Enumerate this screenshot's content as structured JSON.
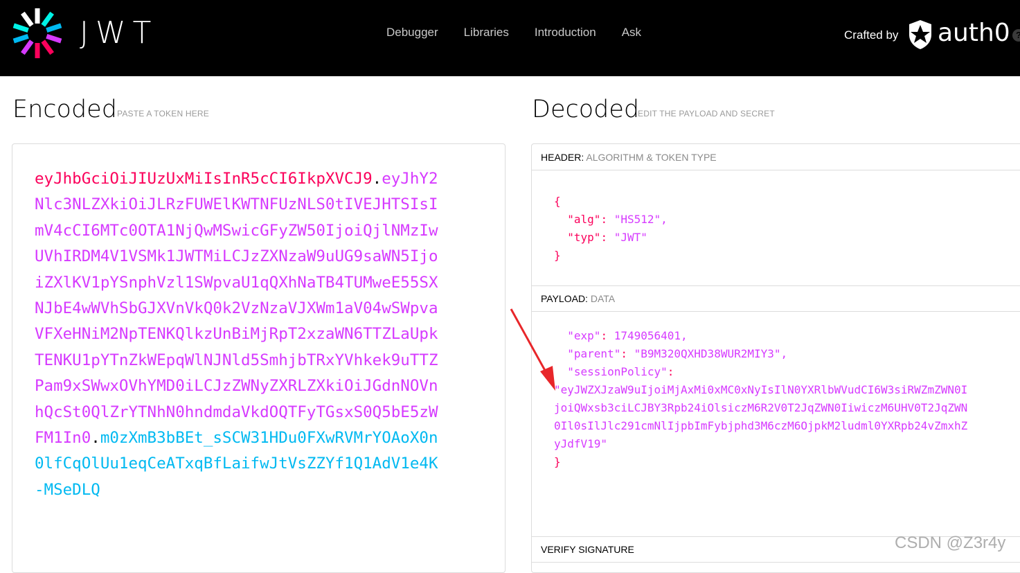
{
  "header": {
    "brand": "JWT",
    "nav": [
      "Debugger",
      "Libraries",
      "Introduction",
      "Ask"
    ],
    "crafted_by": "Crafted by",
    "partner": "auth0",
    "help": "?"
  },
  "encoded": {
    "title": "Encoded",
    "subtitle": "PASTE A TOKEN HERE",
    "token_header": "eyJhbGciOiJIUzUxMiIsInR5cCI6IkpXVCJ9",
    "token_payload": "eyJhY2Nlc3NLZXkiOiJLRzFUWElKWTNFUzNLS0tIVEJHTSIsImV4cCI6MTc0OTA1NjQwMSwicGFyZW50IjoiQjlNMzIwUVhIRDM4V1VSMk1JWTMiLCJzZXNzaW9uUG9saWN5IjoiZXlKV1pYSnphVzl1SWpvaU1qQXhNaTB4TUMweE55SXNJbE4wWVhSbGJXVnVkQ0k2VzNzaVJXWm1aV04wSWpvaVFXeHNiM2NpTENKQlkzUnBiMjRpT2xzaWN6TTZLaUpkTENKU1pYTnZkWEpqWlNJNld5SmhjbTRxYVhkek9uTTZPam9xSWwxOVhYMD0iLCJzZWNyZXRLZXkiOiJGdnNOVnhQcSt0QlZrYTNhN0hndmdaVkdOQTFyTGsxS0Q5bE5zWFM1In0",
    "token_signature": "m0zXmB3bBEt_sSCW31HDu0FXwRVMrYOAoX0n0lfCqOlUu1eqCeATxqBfLaifwJtVsZZYf1Q1AdV1e4K-MSeDLQ"
  },
  "decoded": {
    "title": "Decoded",
    "subtitle": "EDIT THE PAYLOAD AND SECRET",
    "header_label": "HEADER:",
    "header_desc": "ALGORITHM & TOKEN TYPE",
    "payload_label": "PAYLOAD:",
    "payload_desc": "DATA",
    "verify_label": "VERIFY SIGNATURE",
    "header_json": {
      "alg_key": "\"alg\"",
      "alg_val": "\"HS512\",",
      "typ_key": "\"typ\"",
      "typ_val": "\"JWT\""
    },
    "payload_json": {
      "exp_key": "\"exp\"",
      "exp_val": "1749056401,",
      "parent_key": "\"parent\"",
      "parent_val": "\"B9M320QXHD38WUR2MIY3\",",
      "session_key": "\"sessionPolicy\"",
      "session_val": "\"eyJWZXJzaW9uIjoiMjAxMi0xMC0xNyIsIlN0YXRlbWVudCI6W3siRWZmZWN0IjoiQWxsb3ciLCJBY3Rpb24iOlsiczM6R2V0T2JqZWN0IiwiczM6UHV0T2JqZWN0Il0sIlJlc291cmNlIjpbImFybjphd3M6czM6OjpkM2ludml0YXRpb24vZmxhZyJdfV19\""
    }
  },
  "watermark": "CSDN @Z3r4y",
  "colors": {
    "header_red": "#fb015b",
    "payload_purple": "#d63aff",
    "signature_cyan": "#00b9f1"
  }
}
